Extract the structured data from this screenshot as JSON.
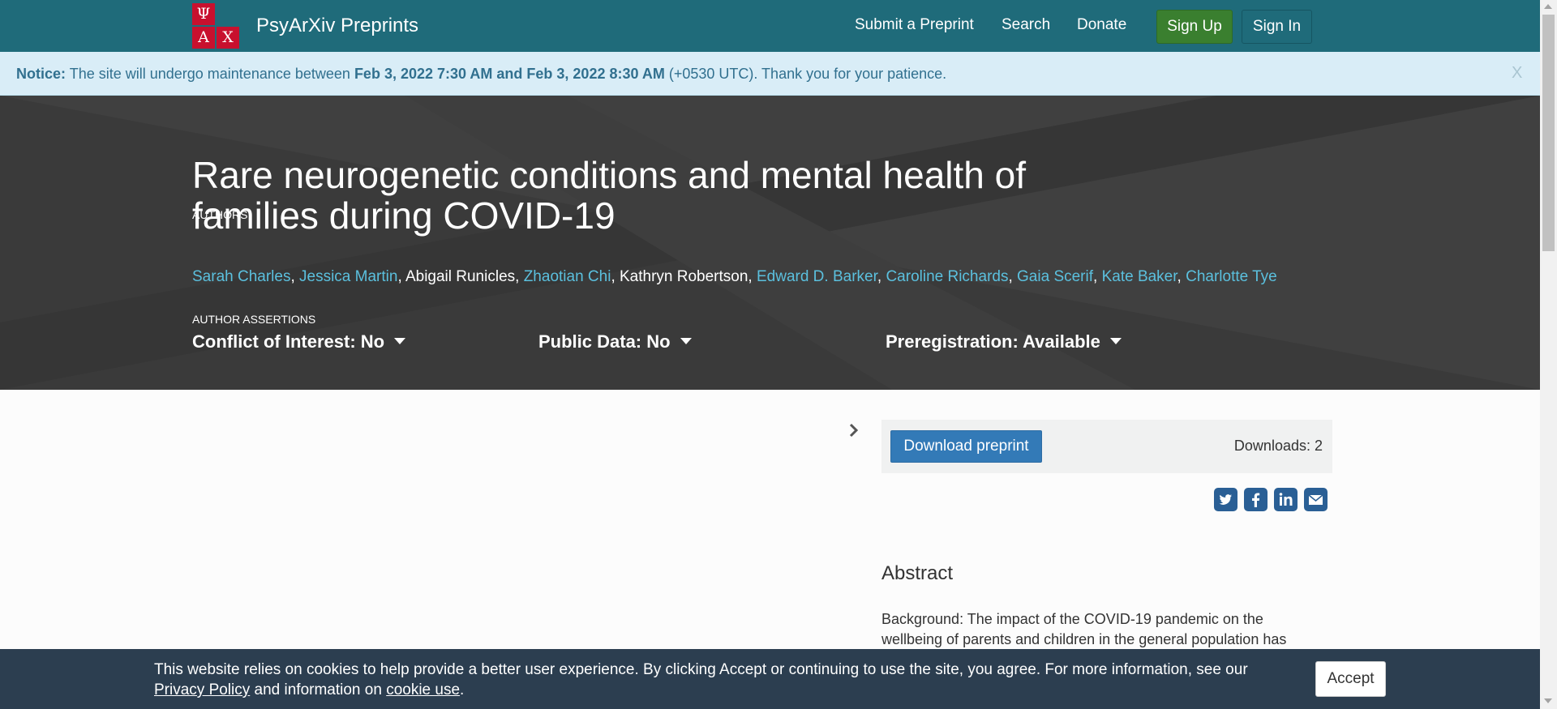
{
  "navbar": {
    "logo_letters": [
      "Ψ",
      "Α",
      "Χ"
    ],
    "brand": "PsyArXiv Preprints",
    "links": {
      "submit": "Submit a Preprint",
      "search": "Search",
      "donate": "Donate"
    },
    "signup": "Sign Up",
    "signin": "Sign In"
  },
  "notice": {
    "label": "Notice:",
    "text1": "The site will undergo maintenance between",
    "start": "Feb 3, 2022 7:30 AM",
    "and": "and",
    "end": "Feb 3, 2022 8:30 AM",
    "text2": "(+0530 UTC). Thank you for your patience.",
    "close": "X"
  },
  "preprint": {
    "title": "Rare neurogenetic conditions and mental health of families during COVID-19",
    "authors_label": "Authors",
    "authors": [
      {
        "name": "Sarah Charles",
        "linked": true
      },
      {
        "name": "Jessica Martin",
        "linked": true
      },
      {
        "name": "Abigail Runicles",
        "linked": false
      },
      {
        "name": "Zhaotian Chi",
        "linked": true
      },
      {
        "name": "Kathryn Robertson",
        "linked": false
      },
      {
        "name": "Edward D. Barker",
        "linked": true
      },
      {
        "name": "Caroline Richards",
        "linked": true
      },
      {
        "name": "Gaia Scerif",
        "linked": true
      },
      {
        "name": "Kate Baker",
        "linked": true
      },
      {
        "name": "Charlotte Tye",
        "linked": true
      }
    ],
    "assertions_label": "Author Assertions",
    "assertions": {
      "conflict": "Conflict of Interest: No",
      "public_data": "Public Data: No",
      "prereg": "Preregistration: Available"
    }
  },
  "download": {
    "button": "Download preprint",
    "count": "Downloads: 2"
  },
  "share": [
    "twitter-icon",
    "facebook-icon",
    "linkedin-icon",
    "email-icon"
  ],
  "abstract": {
    "heading": "Abstract",
    "text": "Background: The impact of the COVID-19 pandemic on the wellbeing of parents and children in the general population has"
  },
  "cookie": {
    "text1": "This website relies on cookies to help provide a better user experience. By clicking Accept or continuing to use the site, you agree. For more information, see our",
    "privacy_link": "Privacy Policy",
    "text2": "and information on",
    "cookie_link": "cookie use",
    "text3": ".",
    "accept": "Accept"
  },
  "colors": {
    "navbar": "#1f6b7a",
    "notice_bg": "#d9edf7",
    "hero_bg": "#3a3a3a",
    "link": "#5bc0de",
    "signup": "#3a7f2f",
    "download": "#337ab7",
    "cookie_bg": "#2c3e50",
    "logo": "#c8102e"
  }
}
